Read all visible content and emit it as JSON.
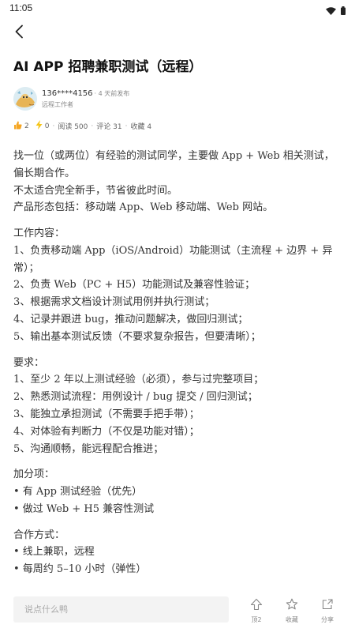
{
  "status_bar": {
    "time": "11:05"
  },
  "post": {
    "title": "AI APP 招聘兼职测试（远程）",
    "author": {
      "name": "136****4156",
      "time": "· 4 天前发布",
      "role": "远程工作者"
    },
    "stats": {
      "likes": "2",
      "boosts": "0",
      "reads": "阅读 500",
      "comments": "评论 31",
      "favorites": "收藏 4"
    },
    "content": {
      "intro": [
        "找一位（或两位）有经验的测试同学，主要做 App + Web 相关测试，",
        "偏长期合作。",
        "不太适合完全新手，节省彼此时间。",
        "产品形态包括：移动端 App、Web 移动端、Web 网站。"
      ],
      "work": [
        "工作内容：",
        "1、负责移动端 App（iOS/Android）功能测试（主流程 + 边界 + 异",
        "常）；",
        "2、负责 Web（PC + H5）功能测试及兼容性验证；",
        "3、根据需求文档设计测试用例并执行测试；",
        "4、记录并跟进 bug，推动问题解决，做回归测试；",
        "5、输出基本测试反馈（不要求复杂报告，但要清晰）；"
      ],
      "req": [
        "要求：",
        "1、至少 2 年以上测试经验（必须），参与过完整项目；",
        "2、熟悉测试流程：用例设计 / bug 提交 / 回归测试；",
        "3、能独立承担测试（不需要手把手带）；",
        "4、对体验有判断力（不仅是功能对错）；",
        "5、沟通顺畅，能远程配合推进；"
      ],
      "bonus": [
        "加分项：",
        "• 有 App 测试经验（优先）",
        "• 做过 Web + H5 兼容性测试"
      ],
      "coop": [
        "合作方式：",
        "• 线上兼职，远程",
        "• 每周约 5–10 小时（弹性）"
      ]
    }
  },
  "bottom_bar": {
    "comment_placeholder": "说点什么鸭",
    "top_label": "顶2",
    "favorite_label": "收藏",
    "share_label": "分享"
  },
  "colors": {
    "like_orange": "#f5a623",
    "bolt_yellow": "#f5c518",
    "text": "#333333",
    "muted": "#888888"
  }
}
